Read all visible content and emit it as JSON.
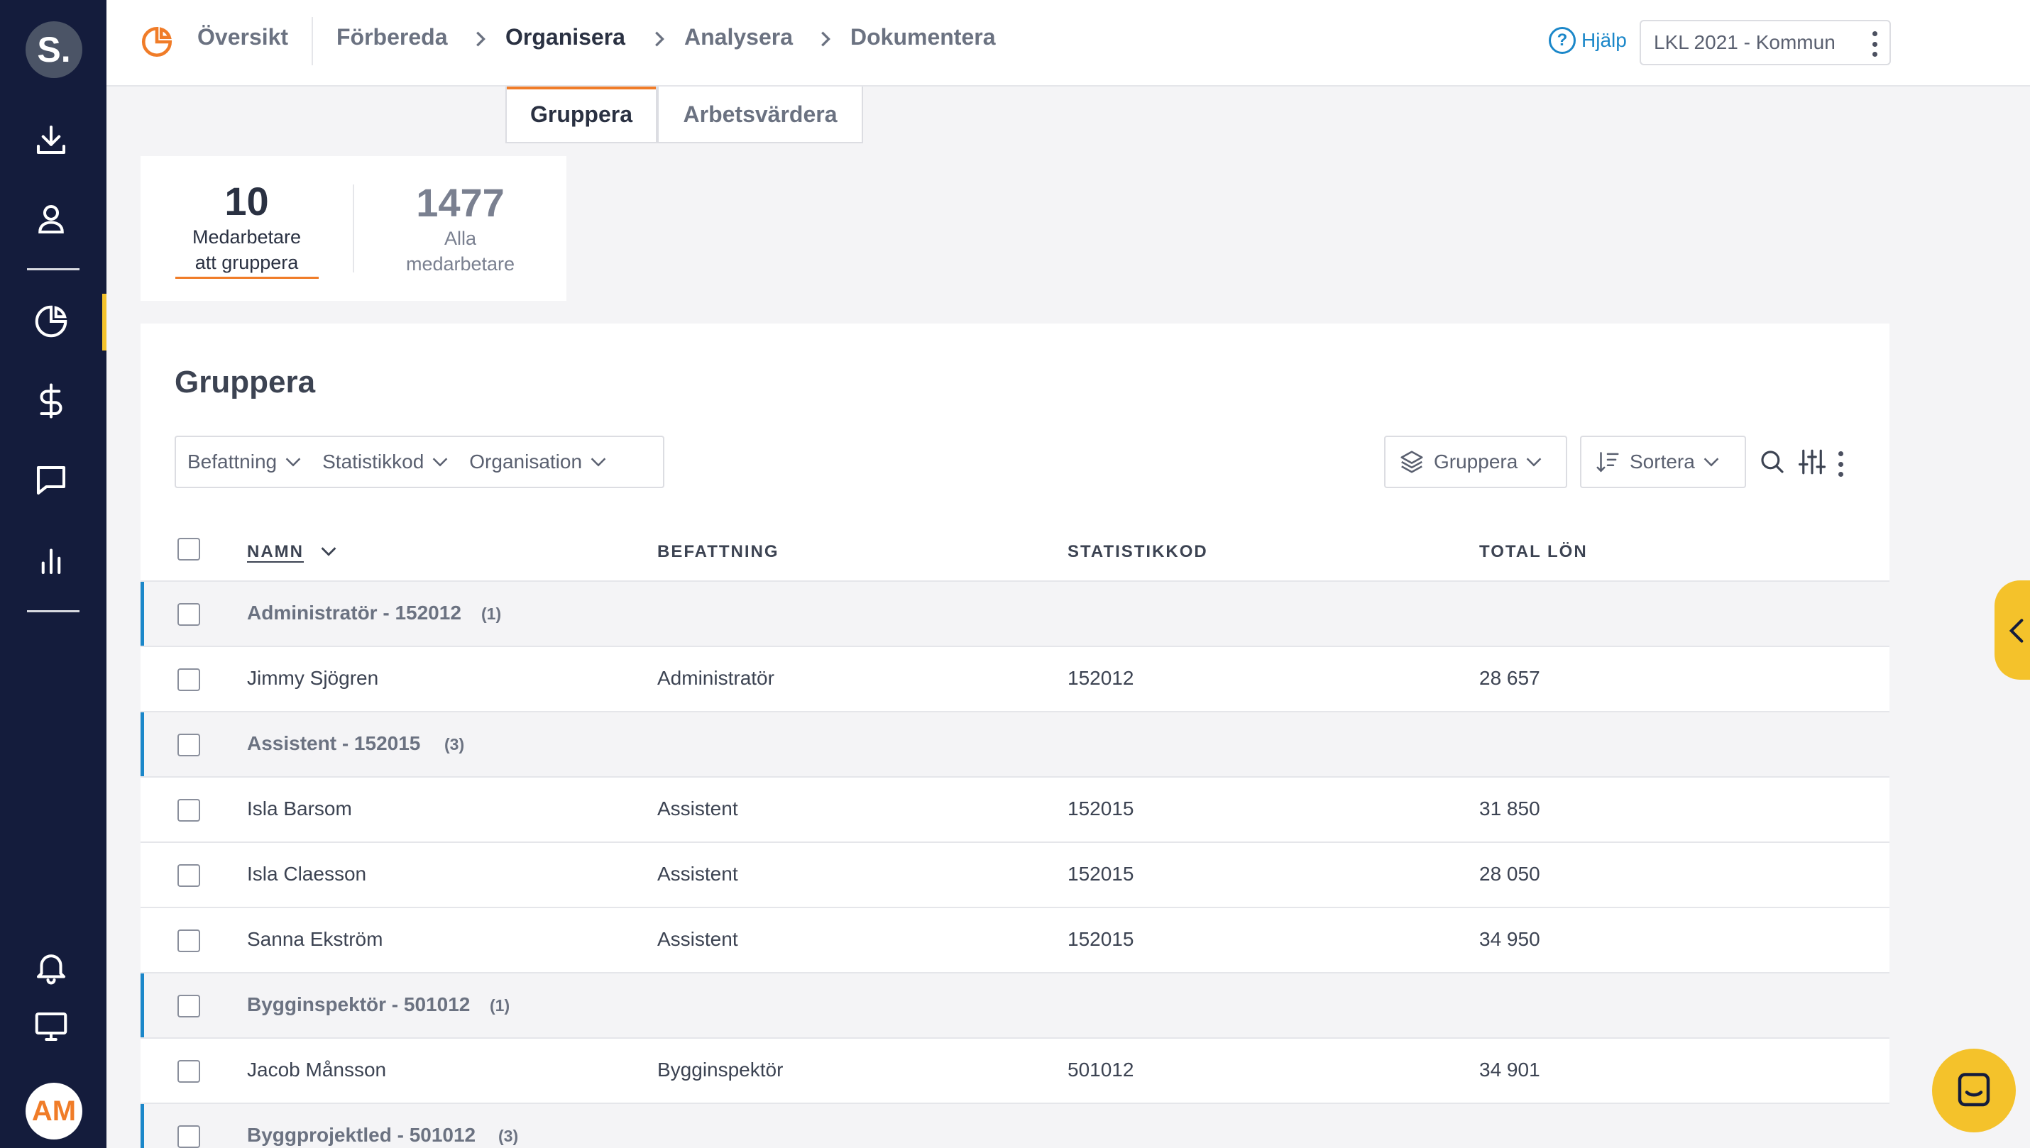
{
  "sidebar": {
    "logo": "S.",
    "avatar": "AM",
    "icons": [
      "download-icon",
      "user-icon",
      "pie-chart-icon",
      "dollar-icon",
      "chat-icon",
      "bar-chart-icon",
      "bell-icon",
      "monitor-icon"
    ]
  },
  "topnav": {
    "items": [
      "Översikt",
      "Förbereda",
      "Organisera",
      "Analysera",
      "Dokumentera"
    ],
    "active": "Organisera",
    "help_label": "Hjälp",
    "help_glyph": "?",
    "selector_value": "LKL 2021 - Kommun"
  },
  "subtabs": [
    "Gruppera",
    "Arbetsvärdera"
  ],
  "stats": [
    {
      "value": "10",
      "label_line1": "Medarbetare",
      "label_line2": "att gruppera"
    },
    {
      "value": "1477",
      "label_line1": "Alla",
      "label_line2": "medarbetare"
    }
  ],
  "card": {
    "title": "Gruppera",
    "filters": [
      "Befattning",
      "Statistikkod",
      "Organisation"
    ],
    "group_button": "Gruppera",
    "sort_button": "Sortera"
  },
  "table": {
    "headers": [
      "NAMN",
      "BEFATTNING",
      "STATISTIKKOD",
      "TOTAL LÖN"
    ],
    "rows": [
      {
        "type": "group",
        "label": "Administratör - 152012",
        "count": "(1)"
      },
      {
        "type": "item",
        "name": "Jimmy Sjögren",
        "befattning": "Administratör",
        "statistikkod": "152012",
        "lon": "28 657"
      },
      {
        "type": "group",
        "label": "Assistent - 152015",
        "count": "(3)"
      },
      {
        "type": "item",
        "name": "Isla Barsom",
        "befattning": "Assistent",
        "statistikkod": "152015",
        "lon": "31 850"
      },
      {
        "type": "item",
        "name": "Isla Claesson",
        "befattning": "Assistent",
        "statistikkod": "152015",
        "lon": "28 050"
      },
      {
        "type": "item",
        "name": "Sanna Ekström",
        "befattning": "Assistent",
        "statistikkod": "152015",
        "lon": "34 950"
      },
      {
        "type": "group",
        "label": "Bygginspektör - 501012",
        "count": "(1)"
      },
      {
        "type": "item",
        "name": "Jacob Månsson",
        "befattning": "Bygginspektör",
        "statistikkod": "501012",
        "lon": "34 901"
      },
      {
        "type": "group",
        "label": "Byggprojektled - 501012",
        "count": "(3)"
      }
    ]
  },
  "colors": {
    "sidebar": "#141c3c",
    "accent_orange": "#f07c28",
    "accent_yellow": "#f4c22b",
    "link_blue": "#1b87c9"
  }
}
